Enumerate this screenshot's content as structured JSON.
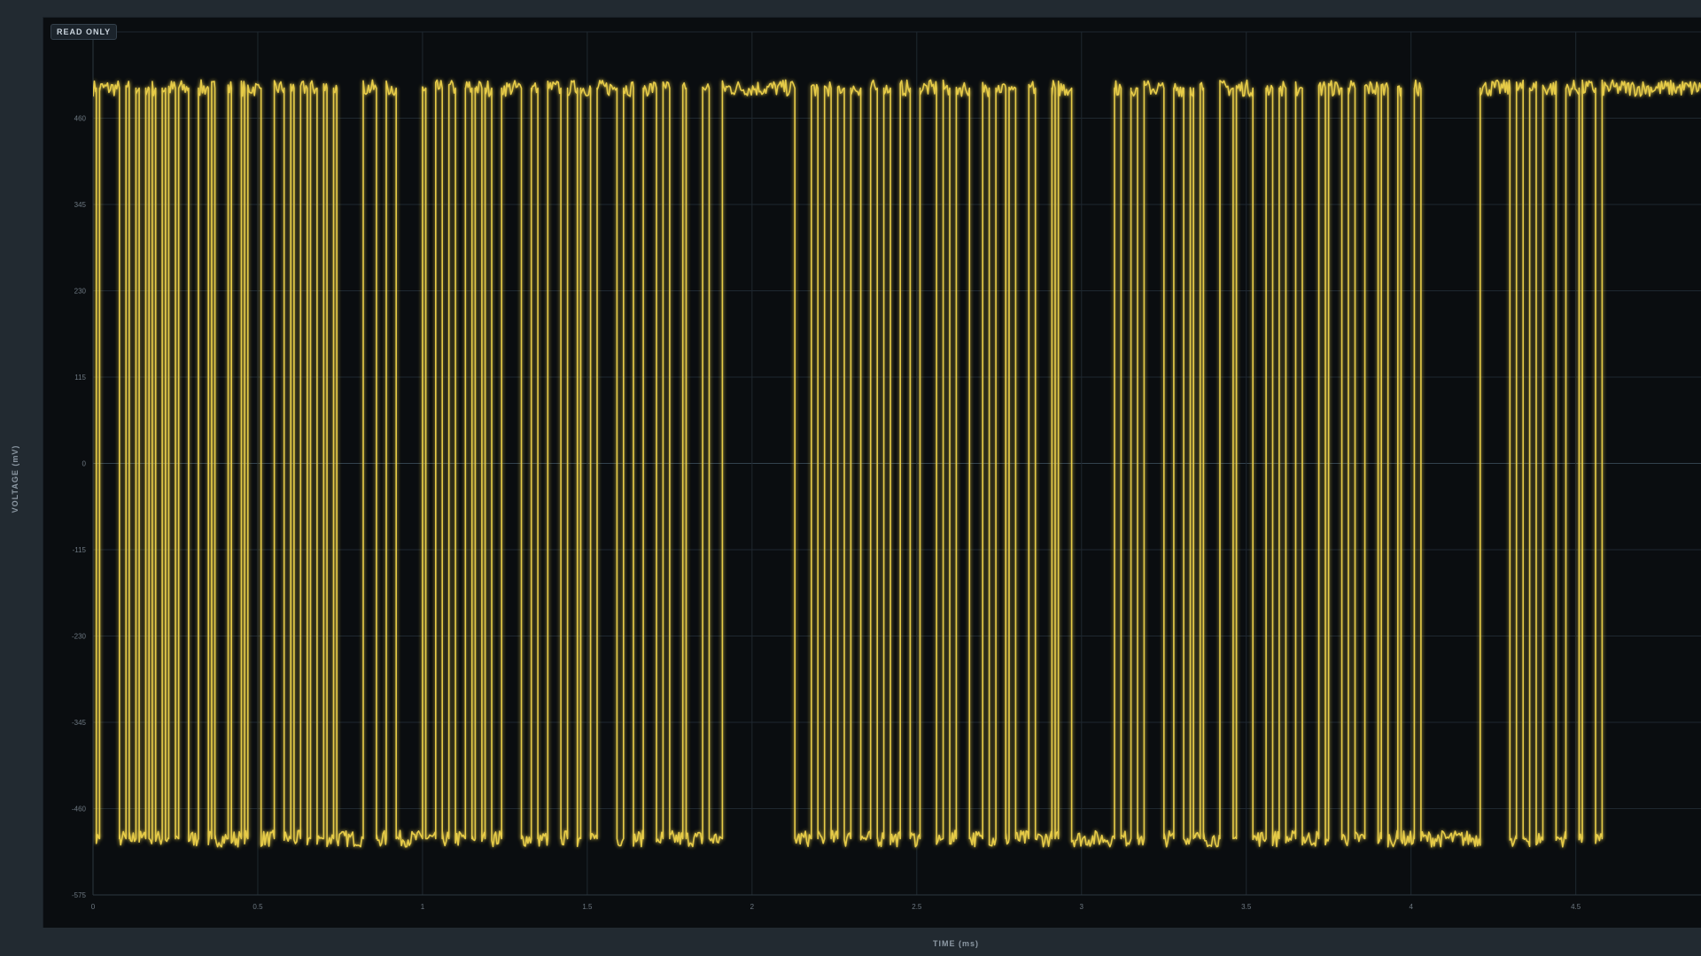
{
  "badge": "READ ONLY",
  "chart_data": {
    "type": "line",
    "title": "",
    "xlabel": "TIME (ms)",
    "ylabel": "VOLTAGE (mV)",
    "xlim": [
      0,
      4.88
    ],
    "ylim": [
      -575,
      575
    ],
    "x_ticks": [
      0,
      0.5,
      1,
      1.5,
      2,
      2.5,
      3,
      3.5,
      4,
      4.5
    ],
    "x_tick_labels": [
      "0",
      "0.5",
      "1",
      "1.5",
      "2",
      "2.5",
      "3",
      "3.5",
      "4",
      "4.5"
    ],
    "y_ticks": [
      460,
      345,
      230,
      115,
      0,
      -115,
      -230,
      -345,
      -460,
      -575
    ],
    "y_tick_labels": [
      "460",
      "345",
      "230",
      "115",
      "0",
      "-115",
      "-230",
      "-345",
      "-460",
      "-575"
    ],
    "grid": true,
    "line_color": "#f2d64b",
    "grid_color": "#1f2830",
    "zero_line_color": "#33424d",
    "series": [
      {
        "high_mv": 500,
        "low_mv": -500,
        "edges_ms": [
          0.01,
          0.02,
          0.08,
          0.1,
          0.11,
          0.13,
          0.14,
          0.16,
          0.17,
          0.18,
          0.19,
          0.21,
          0.22,
          0.23,
          0.25,
          0.26,
          0.29,
          0.32,
          0.35,
          0.36,
          0.37,
          0.41,
          0.42,
          0.45,
          0.46,
          0.47,
          0.51,
          0.55,
          0.58,
          0.6,
          0.61,
          0.63,
          0.65,
          0.66,
          0.68,
          0.7,
          0.71,
          0.73,
          0.74,
          0.82,
          0.86,
          0.89,
          0.92,
          1.0,
          1.01,
          1.04,
          1.06,
          1.08,
          1.1,
          1.13,
          1.15,
          1.16,
          1.18,
          1.19,
          1.21,
          1.24,
          1.3,
          1.33,
          1.35,
          1.38,
          1.42,
          1.44,
          1.47,
          1.48,
          1.51,
          1.53,
          1.59,
          1.61,
          1.64,
          1.67,
          1.71,
          1.73,
          1.75,
          1.79,
          1.8,
          1.85,
          1.87,
          1.91,
          2.13,
          2.18,
          2.2,
          2.22,
          2.24,
          2.26,
          2.28,
          2.3,
          2.33,
          2.36,
          2.38,
          2.4,
          2.42,
          2.45,
          2.48,
          2.51,
          2.56,
          2.58,
          2.6,
          2.62,
          2.66,
          2.7,
          2.72,
          2.74,
          2.77,
          2.78,
          2.8,
          2.84,
          2.86,
          2.91,
          2.92,
          2.93,
          2.97,
          3.1,
          3.12,
          3.15,
          3.17,
          3.19,
          3.25,
          3.28,
          3.31,
          3.33,
          3.34,
          3.36,
          3.37,
          3.42,
          3.46,
          3.47,
          3.52,
          3.56,
          3.58,
          3.6,
          3.62,
          3.65,
          3.67,
          3.72,
          3.74,
          3.75,
          3.79,
          3.81,
          3.83,
          3.86,
          3.9,
          3.91,
          3.93,
          3.96,
          3.97,
          4.01,
          4.03,
          4.21,
          4.3,
          4.32,
          4.34,
          4.36,
          4.38,
          4.4,
          4.44,
          4.47,
          4.51,
          4.52,
          4.56,
          4.58
        ]
      }
    ]
  }
}
